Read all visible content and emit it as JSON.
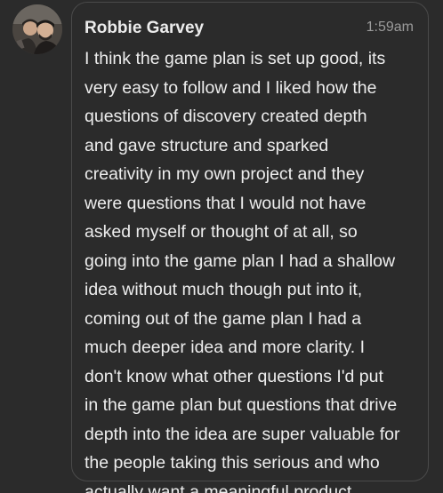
{
  "message": {
    "sender": "Robbie Garvey",
    "time": "1:59am",
    "avatar_icon": "user-avatar-photo",
    "lines": [
      "I think the game plan is set up good, its",
      "very easy to follow and I liked how the",
      "questions of discovery created depth",
      "and gave structure and sparked",
      "creativity in my own project and they",
      "were questions that I would not have",
      "asked myself or thought of at all, so",
      "going into the game plan I had a shallow",
      "idea without much though put into it,",
      "coming out of the game plan I had a",
      "much deeper idea and more clarity. I",
      "don't know what other questions I'd put",
      "in the game plan but questions that drive",
      "depth into the idea are super valuable for",
      "the people taking this serious and who",
      "actually want a meaningful product."
    ]
  },
  "colors": {
    "background": "#2b2b2b",
    "bubble_border": "#4a4a4a",
    "text": "#ededed",
    "timestamp": "#9b9b9b"
  }
}
